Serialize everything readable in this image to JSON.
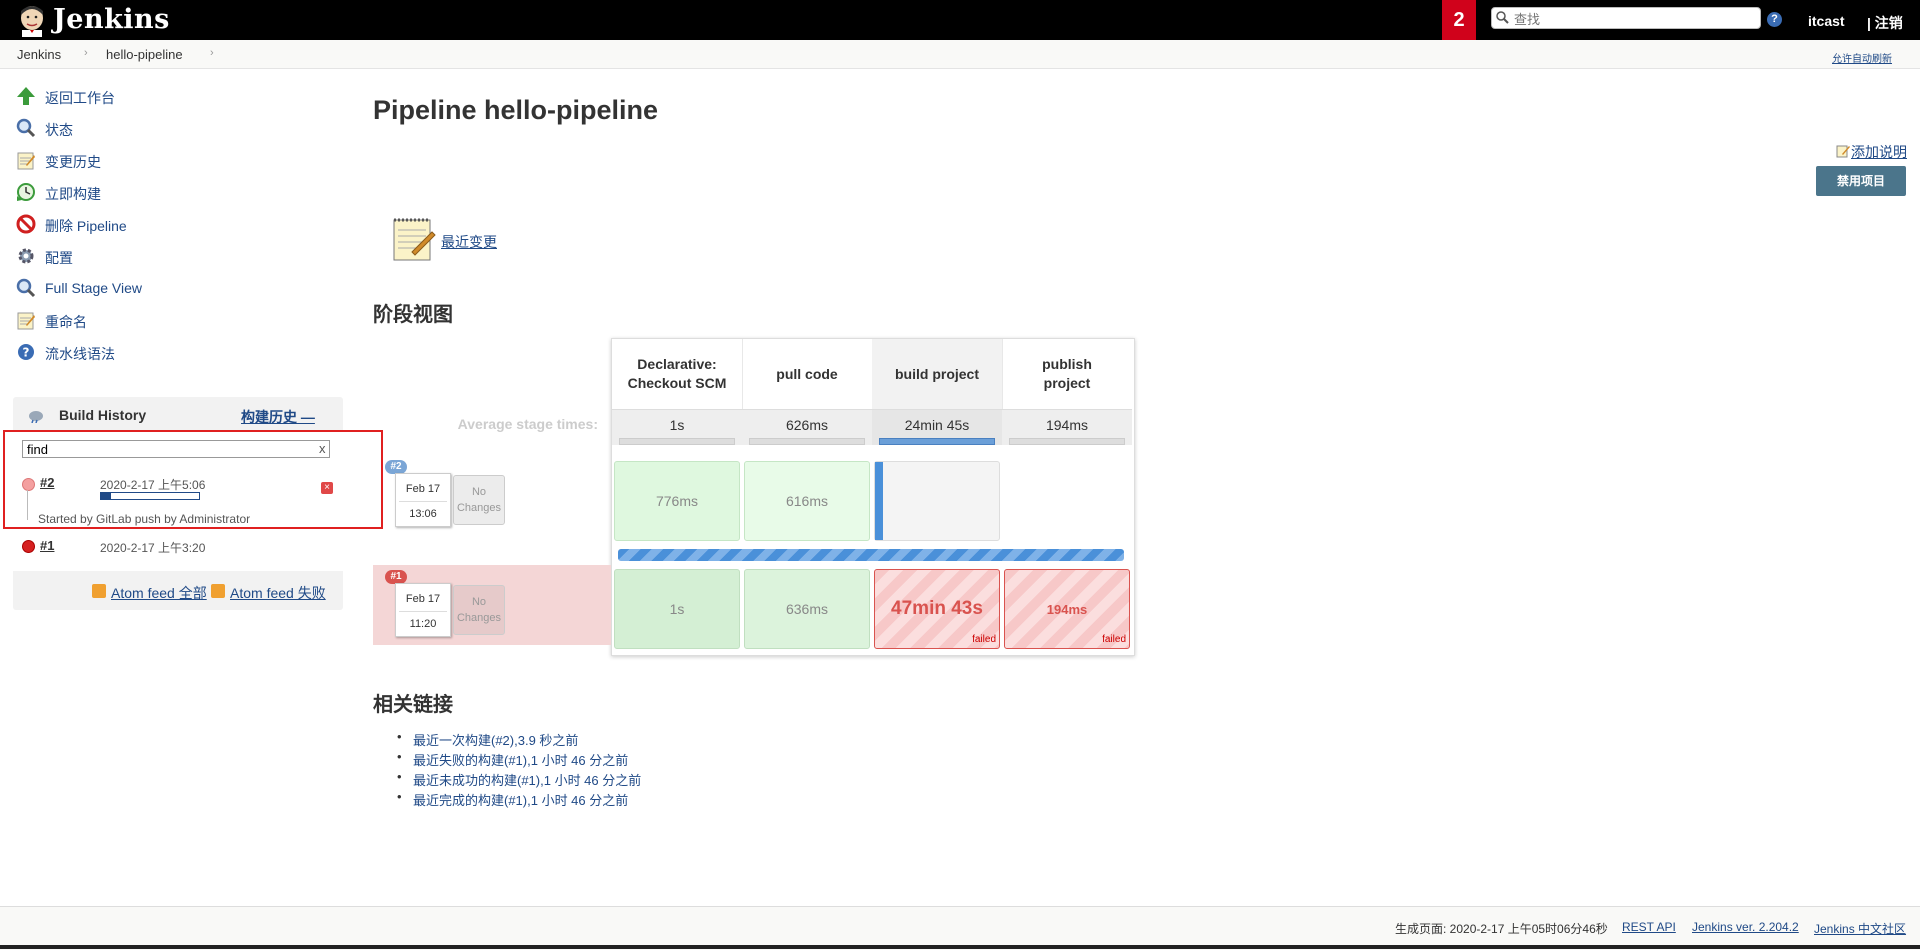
{
  "header": {
    "logo_text": "Jenkins",
    "notification_count": "2",
    "search_placeholder": "查找",
    "help_icon": "?",
    "user": "itcast",
    "logout": "| 注销"
  },
  "breadcrumb": {
    "items": [
      "Jenkins",
      "hello-pipeline"
    ],
    "autorefresh": "允许自动刷新"
  },
  "tasks": [
    {
      "label": "返回工作台",
      "icon": "up-arrow-icon"
    },
    {
      "label": "状态",
      "icon": "search-icon"
    },
    {
      "label": "变更历史",
      "icon": "notepad-icon"
    },
    {
      "label": "立即构建",
      "icon": "build-clock-icon"
    },
    {
      "label": "删除 Pipeline",
      "icon": "no-entry-icon"
    },
    {
      "label": "配置",
      "icon": "gear-icon"
    },
    {
      "label": "Full Stage View",
      "icon": "search-icon"
    },
    {
      "label": "重命名",
      "icon": "notepad-icon"
    },
    {
      "label": "流水线语法",
      "icon": "help-icon"
    }
  ],
  "build_history": {
    "title": "Build History",
    "trend": "构建历史 —",
    "filter_value": "find",
    "filter_clear": "x",
    "builds": [
      {
        "number": "#2",
        "date": "2020-2-17 上午5:06",
        "cause": "Started by GitLab push by Administrator",
        "status": "running",
        "progress": 0.1
      },
      {
        "number": "#1",
        "date": "2020-2-17 上午3:20",
        "status": "failed"
      }
    ],
    "feed_all": "Atom feed 全部",
    "feed_failed": "Atom feed 失败"
  },
  "main": {
    "title": "Pipeline hello-pipeline",
    "add_description": "添加说明",
    "disable_button": "禁用项目",
    "recent_changes": "最近变更",
    "stage_view_title": "阶段视图",
    "related_links_title": "相关链接"
  },
  "stage_view": {
    "avg_label": "Average stage times:",
    "stages": [
      {
        "name_line1": "Declarative:",
        "name_line2": "Checkout SCM",
        "avg": "1s"
      },
      {
        "name_line1": "pull code",
        "name_line2": "",
        "avg": "626ms"
      },
      {
        "name_line1": "build project",
        "name_line2": "",
        "avg": "24min 45s"
      },
      {
        "name_line1": "publish",
        "name_line2": "project",
        "avg": "194ms"
      }
    ],
    "runs": [
      {
        "badge": "#2",
        "month_day": "Feb 17",
        "time": "13:06",
        "changes_line1": "No",
        "changes_line2": "Changes",
        "cells": [
          "776ms",
          "616ms",
          "",
          ""
        ]
      },
      {
        "badge": "#1",
        "month_day": "Feb 17",
        "time": "11:20",
        "changes_line1": "No",
        "changes_line2": "Changes",
        "cells": [
          "1s",
          "636ms",
          "47min 43s",
          "194ms"
        ],
        "failed_label": "failed"
      }
    ]
  },
  "related_links": [
    "最近一次构建(#2),3.9 秒之前",
    "最近失败的构建(#1),1 小时 46 分之前",
    "最近未成功的构建(#1),1 小时 46 分之前",
    "最近完成的构建(#1),1 小时 46 分之前"
  ],
  "footer": {
    "generated": "生成页面: 2020-2-17 上午05时06分46秒",
    "rest_api": "REST API",
    "version": "Jenkins ver. 2.204.2",
    "community": "Jenkins 中文社区"
  },
  "colors": {
    "header_bg": "#000000",
    "notification": "#d0021b",
    "link": "#204A87",
    "success_cell": "#dff8df",
    "failed_cell": "#f8d7d7",
    "running_bar": "#4a90d9"
  }
}
